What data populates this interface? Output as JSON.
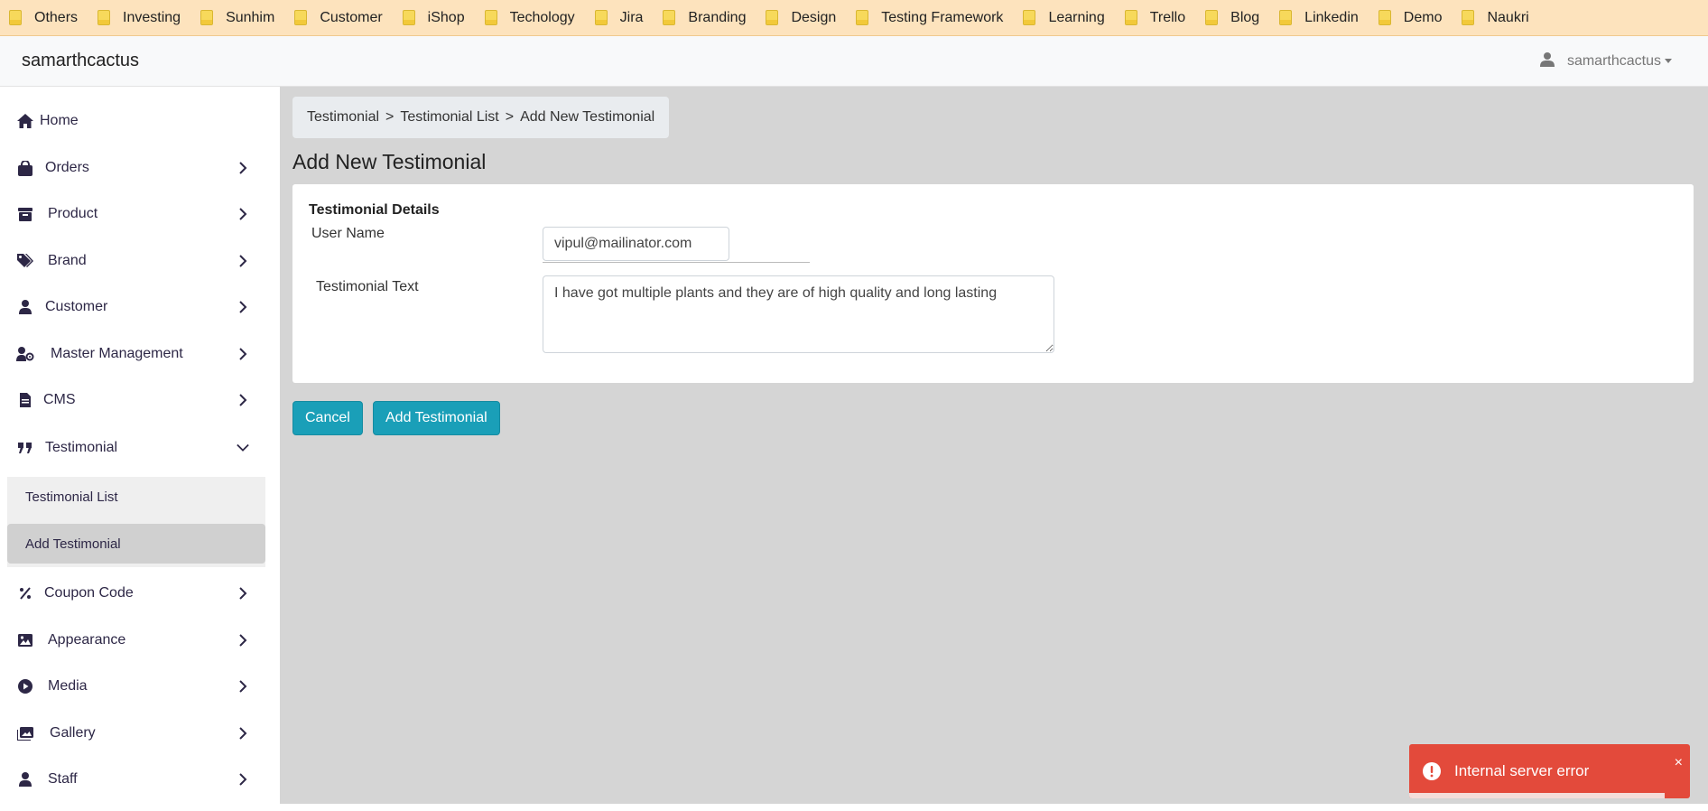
{
  "bookmarks": [
    "Others",
    "Investing",
    "Sunhim",
    "Customer",
    "iShop",
    "Techology",
    "Jira",
    "Branding",
    "Design",
    "Testing Framework",
    "Learning",
    "Trello",
    "Blog",
    "Linkedin",
    "Demo",
    "Naukri"
  ],
  "navbar": {
    "brand": "samarthcactus",
    "user": "samarthcactus"
  },
  "sidebar": {
    "items": [
      {
        "label": "Home",
        "icon": "home-icon"
      },
      {
        "label": "Orders",
        "icon": "shopping-bag-icon"
      },
      {
        "label": "Product",
        "icon": "archive-icon"
      },
      {
        "label": "Brand",
        "icon": "tags-icon"
      },
      {
        "label": "Customer",
        "icon": "user-icon"
      },
      {
        "label": "Master Management",
        "icon": "user-cog-icon"
      },
      {
        "label": "CMS",
        "icon": "file-icon"
      },
      {
        "label": "Testimonial",
        "icon": "quote-icon"
      },
      {
        "label": "Coupon Code",
        "icon": "percent-icon"
      },
      {
        "label": "Appearance",
        "icon": "image-icon"
      },
      {
        "label": "Media",
        "icon": "play-circle-icon"
      },
      {
        "label": "Gallery",
        "icon": "images-icon"
      },
      {
        "label": "Staff",
        "icon": "user-icon"
      }
    ],
    "testimonial_sub": [
      "Testimonial List",
      "Add Testimonial"
    ],
    "active_sub": "Add Testimonial"
  },
  "breadcrumb": [
    "Testimonial",
    "Testimonial List",
    "Add New Testimonial"
  ],
  "breadcrumb_sep": ">",
  "page_title": "Add New Testimonial",
  "form": {
    "section_title": "Testimonial Details",
    "username_label": "User Name",
    "username_value": "vipul@mailinator.com",
    "text_label": "Testimonial Text",
    "text_value": "I have got multiple plants and they are of high quality and long lasting"
  },
  "buttons": {
    "cancel": "Cancel",
    "add": "Add Testimonial"
  },
  "toast": {
    "message": "Internal server error",
    "close": "×",
    "progress": 0.91
  },
  "colors": {
    "bookmark_bar": "#fde3bd",
    "primary": "#1a9fb8",
    "toast": "#e34a3b",
    "main_bg": "#d5d5d5"
  }
}
